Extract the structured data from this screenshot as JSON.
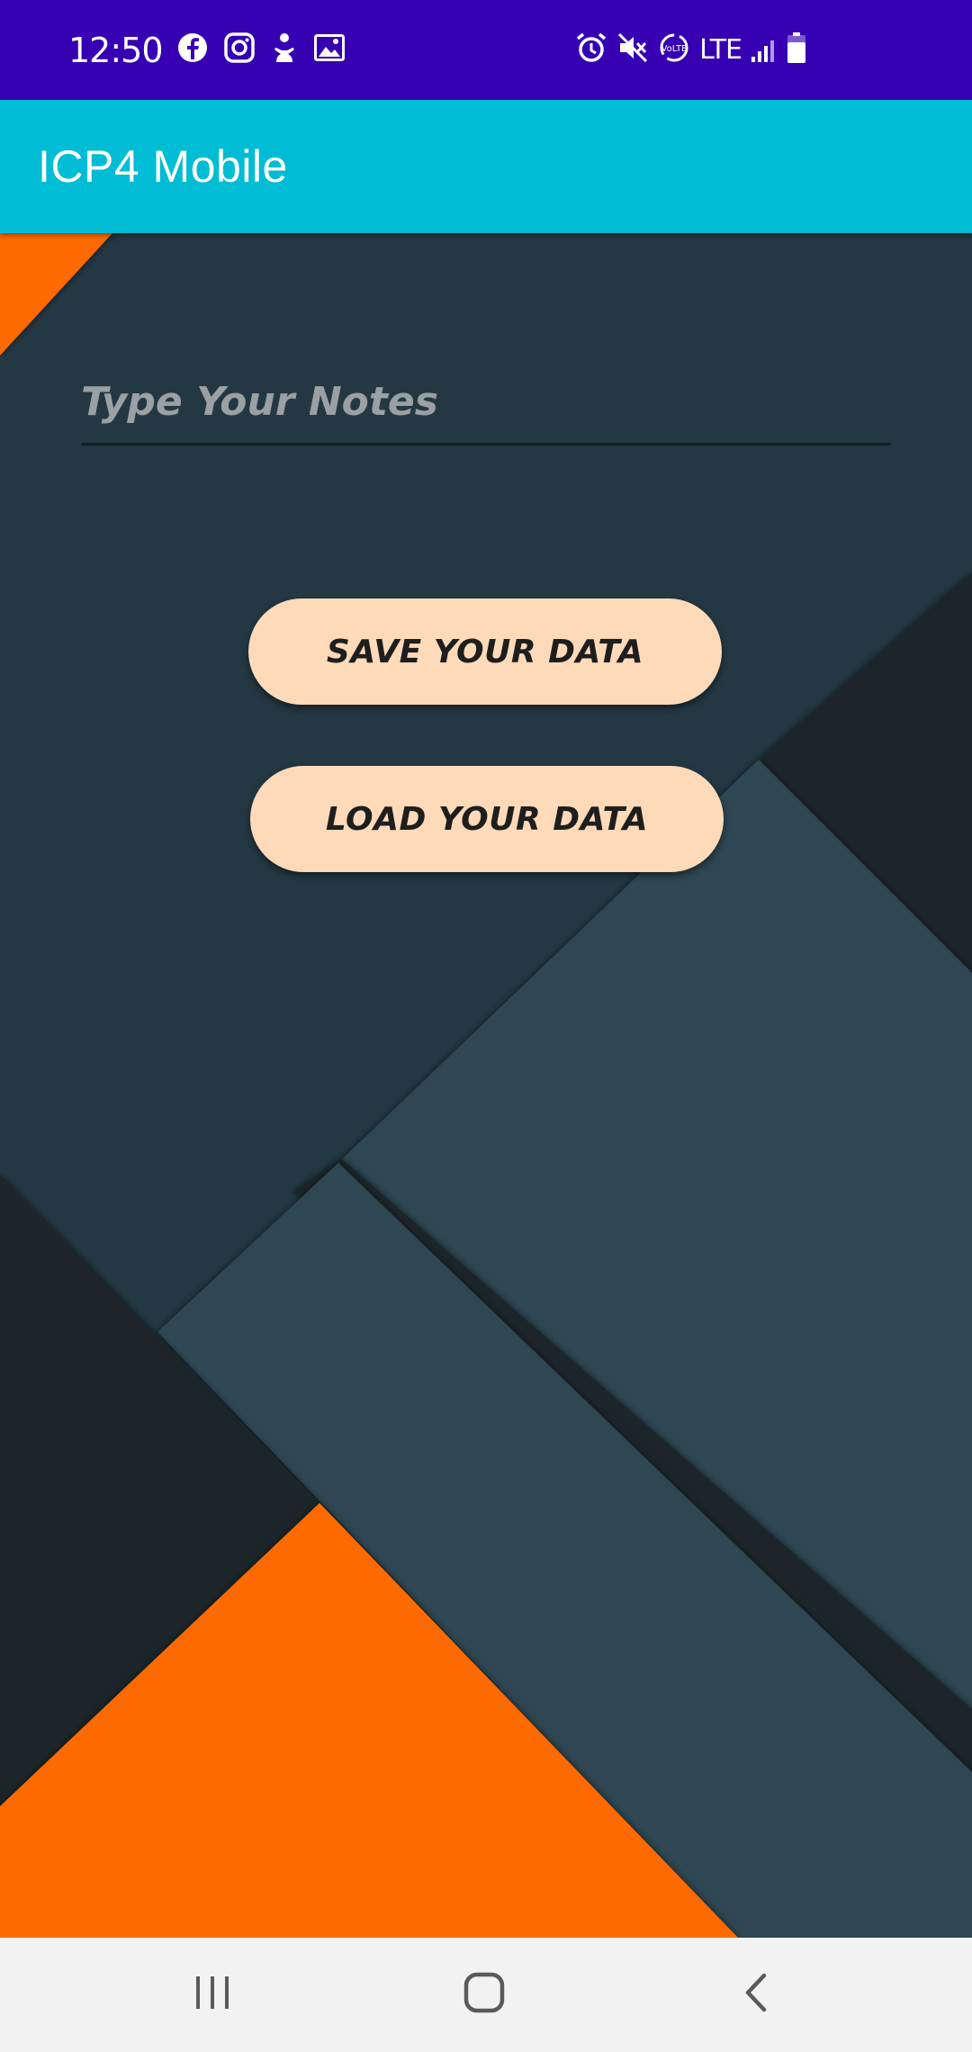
{
  "status_bar": {
    "time": "12:50",
    "left_icons": [
      "facebook-icon",
      "instagram-icon",
      "accessibility-icon",
      "image-icon"
    ],
    "right_icons": [
      "alarm-icon",
      "mute-icon",
      "volte-icon",
      "lte-icon",
      "signal-icon",
      "battery-icon"
    ],
    "network_label": "LTE",
    "background_color": "#3700b3"
  },
  "app_bar": {
    "title": "ICP4 Mobile",
    "background_color": "#00bcd4"
  },
  "notes": {
    "placeholder": "Type Your Notes",
    "value": ""
  },
  "buttons": {
    "save_label": "SAVE YOUR DATA",
    "load_label": "LOAD YOUR DATA",
    "background_color": "#ffdab9"
  },
  "background": {
    "colors": {
      "base": "#233843",
      "dark": "#1b252b",
      "light": "#2f4752",
      "accent": "#ff6a00"
    }
  },
  "nav_bar": {
    "buttons": [
      "recents-icon",
      "home-icon",
      "back-icon"
    ]
  }
}
